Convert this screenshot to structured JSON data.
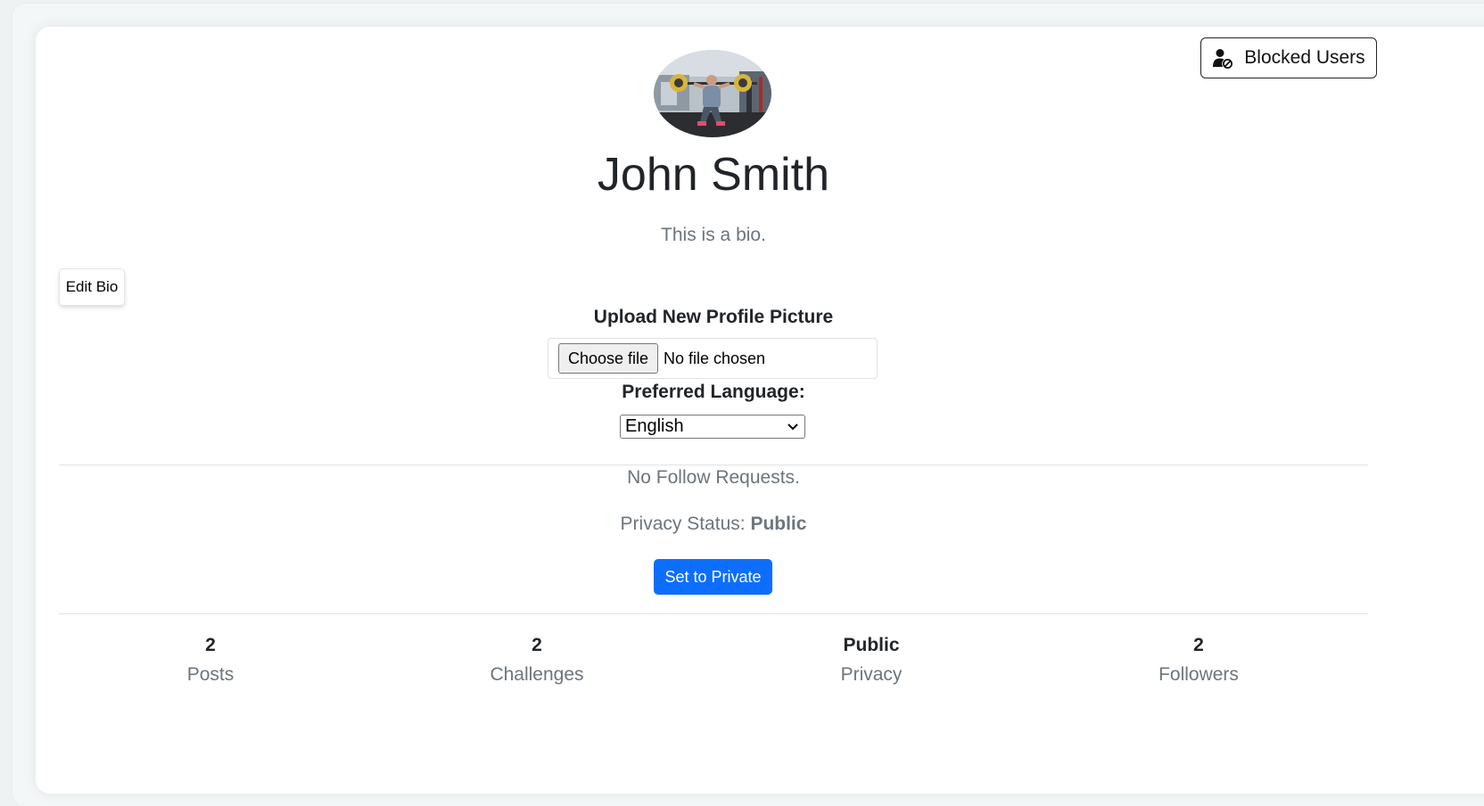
{
  "header": {
    "blocked_users_label": "Blocked Users",
    "blocked_users_icon": "user-block-icon"
  },
  "profile": {
    "avatar_alt": "profile-photo",
    "name": "John Smith",
    "bio": "This is a bio.",
    "edit_bio_label": "Edit Bio"
  },
  "upload": {
    "label": "Upload New Profile Picture",
    "choose_label": "Choose file",
    "status": "No file chosen"
  },
  "language": {
    "label": "Preferred Language:",
    "selected": "English"
  },
  "follow": {
    "requests_text": "No Follow Requests."
  },
  "privacy": {
    "prefix": "Privacy Status:",
    "status": "Public",
    "toggle_label": "Set to Private"
  },
  "stats": [
    {
      "value": "2",
      "label": "Posts"
    },
    {
      "value": "2",
      "label": "Challenges"
    },
    {
      "value": "Public",
      "label": "Privacy"
    },
    {
      "value": "2",
      "label": "Followers"
    }
  ],
  "colors": {
    "primary": "#0d6efd",
    "muted_text": "#6c757d",
    "body_text": "#212529"
  }
}
